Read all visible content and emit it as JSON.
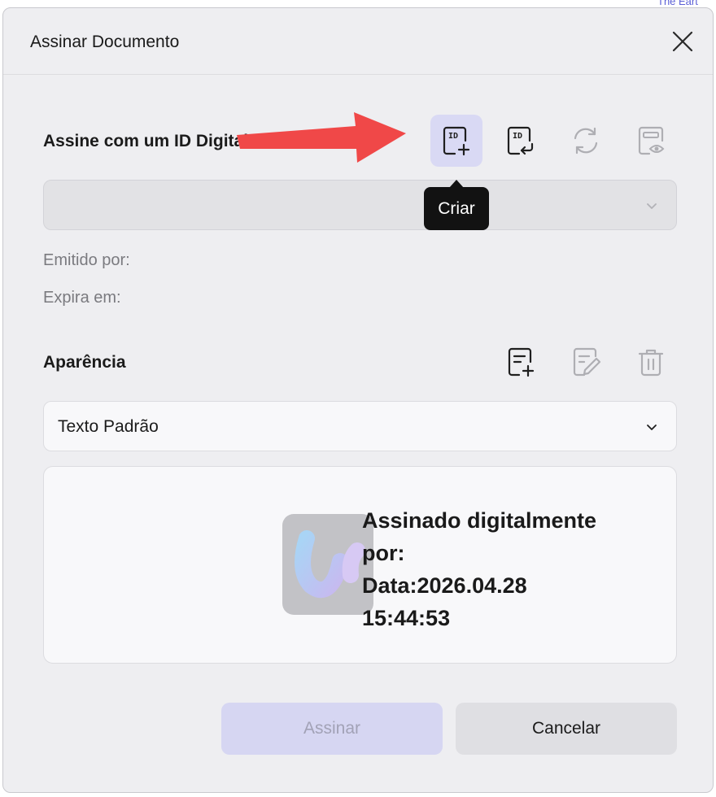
{
  "background": {
    "link_text": "The Eart"
  },
  "dialog": {
    "title": "Assinar Documento",
    "close_icon": "close-icon"
  },
  "digital_id": {
    "label": "Assine com um ID Digital",
    "buttons": [
      {
        "icon": "id-create-icon",
        "state": "active"
      },
      {
        "icon": "id-import-icon",
        "state": "enabled"
      },
      {
        "icon": "refresh-icon",
        "state": "disabled"
      },
      {
        "icon": "id-view-icon",
        "state": "disabled"
      }
    ],
    "tooltip": "Criar",
    "select_value": "",
    "issued_by_label": "Emitido por:",
    "expires_label": "Expira em:"
  },
  "appearance": {
    "label": "Aparência",
    "buttons": [
      {
        "icon": "add-appearance-icon",
        "state": "enabled"
      },
      {
        "icon": "edit-icon",
        "state": "disabled"
      },
      {
        "icon": "trash-icon",
        "state": "disabled"
      }
    ],
    "select_value": "Texto Padrão",
    "preview": {
      "line1": "Assinado digitalmente",
      "line2": "por:",
      "line3": "Data:2026.04.28",
      "line4": "15:44:53"
    }
  },
  "actions": {
    "sign_label": "Assinar",
    "cancel_label": "Cancelar"
  },
  "colors": {
    "accent": "#d9d9f4",
    "annotation_arrow": "#f04848"
  }
}
